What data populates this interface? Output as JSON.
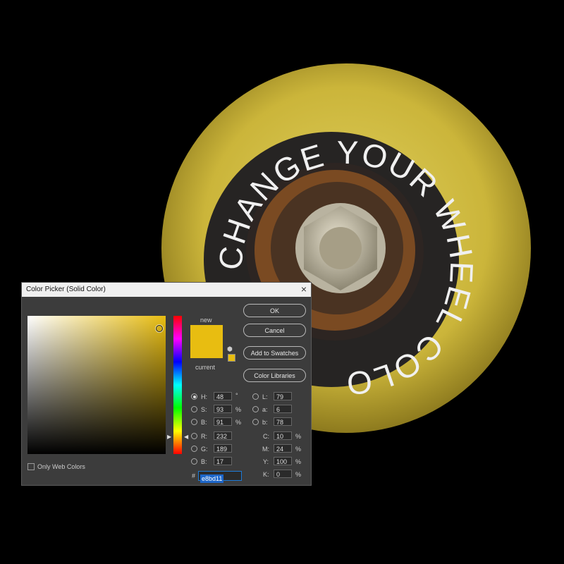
{
  "banner": {
    "text": "CHANGE YOUR WHEEL COLOR"
  },
  "dialog": {
    "title": "Color Picker (Solid Color)",
    "close": "×",
    "new_label": "new",
    "current_label": "current",
    "buttons": {
      "ok": "OK",
      "cancel": "Cancel",
      "add_swatches": "Add to Swatches",
      "libraries": "Color Libraries"
    },
    "only_web": "Only Web Colors",
    "colors": {
      "new": "#e8bd11",
      "current": "#e8bd11"
    },
    "hsb": {
      "h_label": "H:",
      "h": "48",
      "h_unit": "°",
      "s_label": "S:",
      "s": "93",
      "s_unit": "%",
      "b_label": "B:",
      "b": "91",
      "b_unit": "%"
    },
    "rgb": {
      "r_label": "R:",
      "r": "232",
      "g_label": "G:",
      "g": "189",
      "b_label": "B:",
      "b": "17"
    },
    "lab": {
      "l_label": "L:",
      "l": "79",
      "a_label": "a:",
      "a": "6",
      "b_label": "b:",
      "b": "78"
    },
    "cmyk": {
      "c_label": "C:",
      "c": "10",
      "m_label": "M:",
      "m": "24",
      "y_label": "Y:",
      "y": "100",
      "k_label": "K:",
      "k": "0",
      "unit": "%"
    },
    "hex_label": "#",
    "hex": "e8bd11"
  }
}
